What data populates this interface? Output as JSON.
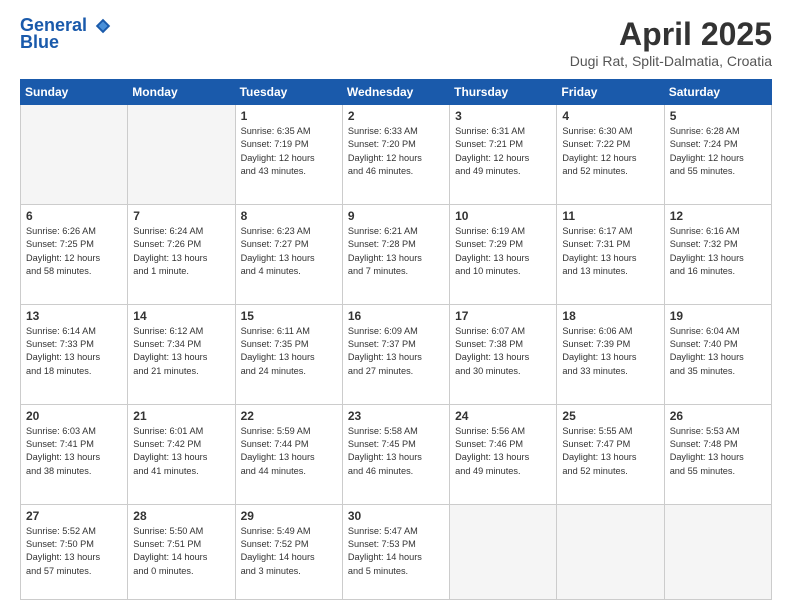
{
  "header": {
    "logo_line1": "General",
    "logo_line2": "Blue",
    "month_title": "April 2025",
    "location": "Dugi Rat, Split-Dalmatia, Croatia"
  },
  "days_of_week": [
    "Sunday",
    "Monday",
    "Tuesday",
    "Wednesday",
    "Thursday",
    "Friday",
    "Saturday"
  ],
  "weeks": [
    [
      {
        "day": "",
        "info": ""
      },
      {
        "day": "",
        "info": ""
      },
      {
        "day": "1",
        "info": "Sunrise: 6:35 AM\nSunset: 7:19 PM\nDaylight: 12 hours\nand 43 minutes."
      },
      {
        "day": "2",
        "info": "Sunrise: 6:33 AM\nSunset: 7:20 PM\nDaylight: 12 hours\nand 46 minutes."
      },
      {
        "day": "3",
        "info": "Sunrise: 6:31 AM\nSunset: 7:21 PM\nDaylight: 12 hours\nand 49 minutes."
      },
      {
        "day": "4",
        "info": "Sunrise: 6:30 AM\nSunset: 7:22 PM\nDaylight: 12 hours\nand 52 minutes."
      },
      {
        "day": "5",
        "info": "Sunrise: 6:28 AM\nSunset: 7:24 PM\nDaylight: 12 hours\nand 55 minutes."
      }
    ],
    [
      {
        "day": "6",
        "info": "Sunrise: 6:26 AM\nSunset: 7:25 PM\nDaylight: 12 hours\nand 58 minutes."
      },
      {
        "day": "7",
        "info": "Sunrise: 6:24 AM\nSunset: 7:26 PM\nDaylight: 13 hours\nand 1 minute."
      },
      {
        "day": "8",
        "info": "Sunrise: 6:23 AM\nSunset: 7:27 PM\nDaylight: 13 hours\nand 4 minutes."
      },
      {
        "day": "9",
        "info": "Sunrise: 6:21 AM\nSunset: 7:28 PM\nDaylight: 13 hours\nand 7 minutes."
      },
      {
        "day": "10",
        "info": "Sunrise: 6:19 AM\nSunset: 7:29 PM\nDaylight: 13 hours\nand 10 minutes."
      },
      {
        "day": "11",
        "info": "Sunrise: 6:17 AM\nSunset: 7:31 PM\nDaylight: 13 hours\nand 13 minutes."
      },
      {
        "day": "12",
        "info": "Sunrise: 6:16 AM\nSunset: 7:32 PM\nDaylight: 13 hours\nand 16 minutes."
      }
    ],
    [
      {
        "day": "13",
        "info": "Sunrise: 6:14 AM\nSunset: 7:33 PM\nDaylight: 13 hours\nand 18 minutes."
      },
      {
        "day": "14",
        "info": "Sunrise: 6:12 AM\nSunset: 7:34 PM\nDaylight: 13 hours\nand 21 minutes."
      },
      {
        "day": "15",
        "info": "Sunrise: 6:11 AM\nSunset: 7:35 PM\nDaylight: 13 hours\nand 24 minutes."
      },
      {
        "day": "16",
        "info": "Sunrise: 6:09 AM\nSunset: 7:37 PM\nDaylight: 13 hours\nand 27 minutes."
      },
      {
        "day": "17",
        "info": "Sunrise: 6:07 AM\nSunset: 7:38 PM\nDaylight: 13 hours\nand 30 minutes."
      },
      {
        "day": "18",
        "info": "Sunrise: 6:06 AM\nSunset: 7:39 PM\nDaylight: 13 hours\nand 33 minutes."
      },
      {
        "day": "19",
        "info": "Sunrise: 6:04 AM\nSunset: 7:40 PM\nDaylight: 13 hours\nand 35 minutes."
      }
    ],
    [
      {
        "day": "20",
        "info": "Sunrise: 6:03 AM\nSunset: 7:41 PM\nDaylight: 13 hours\nand 38 minutes."
      },
      {
        "day": "21",
        "info": "Sunrise: 6:01 AM\nSunset: 7:42 PM\nDaylight: 13 hours\nand 41 minutes."
      },
      {
        "day": "22",
        "info": "Sunrise: 5:59 AM\nSunset: 7:44 PM\nDaylight: 13 hours\nand 44 minutes."
      },
      {
        "day": "23",
        "info": "Sunrise: 5:58 AM\nSunset: 7:45 PM\nDaylight: 13 hours\nand 46 minutes."
      },
      {
        "day": "24",
        "info": "Sunrise: 5:56 AM\nSunset: 7:46 PM\nDaylight: 13 hours\nand 49 minutes."
      },
      {
        "day": "25",
        "info": "Sunrise: 5:55 AM\nSunset: 7:47 PM\nDaylight: 13 hours\nand 52 minutes."
      },
      {
        "day": "26",
        "info": "Sunrise: 5:53 AM\nSunset: 7:48 PM\nDaylight: 13 hours\nand 55 minutes."
      }
    ],
    [
      {
        "day": "27",
        "info": "Sunrise: 5:52 AM\nSunset: 7:50 PM\nDaylight: 13 hours\nand 57 minutes."
      },
      {
        "day": "28",
        "info": "Sunrise: 5:50 AM\nSunset: 7:51 PM\nDaylight: 14 hours\nand 0 minutes."
      },
      {
        "day": "29",
        "info": "Sunrise: 5:49 AM\nSunset: 7:52 PM\nDaylight: 14 hours\nand 3 minutes."
      },
      {
        "day": "30",
        "info": "Sunrise: 5:47 AM\nSunset: 7:53 PM\nDaylight: 14 hours\nand 5 minutes."
      },
      {
        "day": "",
        "info": ""
      },
      {
        "day": "",
        "info": ""
      },
      {
        "day": "",
        "info": ""
      }
    ]
  ]
}
